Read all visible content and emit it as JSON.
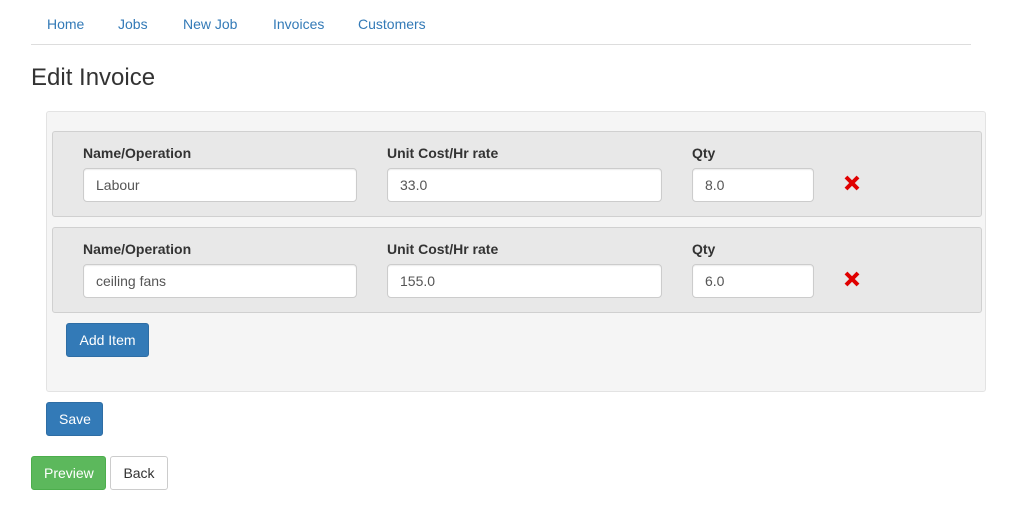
{
  "nav": {
    "items": [
      {
        "label": "Home"
      },
      {
        "label": "Jobs"
      },
      {
        "label": "New Job"
      },
      {
        "label": "Invoices"
      },
      {
        "label": "Customers"
      }
    ]
  },
  "page": {
    "title": "Edit Invoice"
  },
  "items": [
    {
      "name_label": "Name/Operation",
      "name_value": "Labour",
      "cost_label": "Unit Cost/Hr rate",
      "cost_value": "33.0",
      "qty_label": "Qty",
      "qty_value": "8.0",
      "delete_icon": "close-icon",
      "delete_color": "#e00000"
    },
    {
      "name_label": "Name/Operation",
      "name_value": "ceiling fans",
      "cost_label": "Unit Cost/Hr rate",
      "cost_value": "155.0",
      "qty_label": "Qty",
      "qty_value": "6.0",
      "delete_icon": "close-icon",
      "delete_color": "#e00000"
    }
  ],
  "buttons": {
    "add_item": "Add Item",
    "save": "Save",
    "preview": "Preview",
    "back": "Back"
  },
  "colors": {
    "primary": "#337ab7",
    "success": "#5cb85c",
    "link": "#337ab7"
  }
}
